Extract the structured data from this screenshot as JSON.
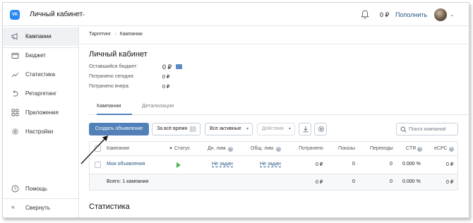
{
  "header": {
    "logo_text": "VK",
    "title": "Личный кабинет",
    "balance": "0 ₽",
    "topup_label": "Пополнить"
  },
  "sidebar": {
    "items": [
      {
        "label": "Кампании",
        "icon": "megaphone-icon",
        "active": true
      },
      {
        "label": "Бюджет",
        "icon": "wallet-icon"
      },
      {
        "label": "Статистика",
        "icon": "chart-icon"
      },
      {
        "label": "Ретаргетинг",
        "icon": "retarget-icon"
      },
      {
        "label": "Приложения",
        "icon": "apps-icon"
      },
      {
        "label": "Настройки",
        "icon": "gear-icon"
      }
    ],
    "help_label": "Помощь",
    "collapse_label": "Свернуть"
  },
  "breadcrumb": {
    "items": [
      "Таргетинг",
      "Кампании"
    ],
    "separator": "›"
  },
  "page": {
    "title": "Личный кабинет",
    "stats": [
      {
        "label": "Оставшийся бюджет:",
        "value": "0 ₽"
      },
      {
        "label": "Потрачено сегодня:",
        "value": "0 ₽"
      },
      {
        "label": "Потрачено вчера:",
        "value": "0 ₽"
      }
    ]
  },
  "tabs": [
    {
      "label": "Кампании",
      "active": true
    },
    {
      "label": "Детализация",
      "active": false
    }
  ],
  "toolbar": {
    "create_label": "Создать объявление",
    "period_label": "За всё время",
    "filter_label": "Все активные",
    "actions_label": "Действия",
    "search_placeholder": "Поиск кампаний"
  },
  "table": {
    "headers": {
      "campaign": "Кампания",
      "status": "Статус",
      "day_limit": "Дн. лим.",
      "total_limit": "Общ. лим.",
      "spent": "Потрачено",
      "impressions": "Показы",
      "clicks": "Переходы",
      "ctr": "CTR",
      "ecpc": "eCPC"
    },
    "rows": [
      {
        "name": "Мои объявления",
        "day_limit": "Не задан",
        "total_limit": "Не задан",
        "spent": "0 ₽",
        "impressions": "0",
        "clicks": "0",
        "ctr": "0.000 %",
        "ecpc": "0 ₽"
      }
    ],
    "footer": {
      "label": "Всего: 1 кампания",
      "spent": "0 ₽",
      "impressions": "0",
      "clicks": "0",
      "ctr": "0.000 %",
      "ecpc": "0 ₽"
    }
  },
  "statistics_title": "Статистика",
  "colors": {
    "accent": "#5181b8",
    "link": "#2a5885",
    "status_active": "#4bb34b"
  }
}
